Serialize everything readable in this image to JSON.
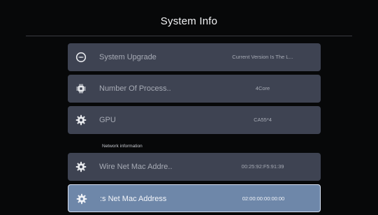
{
  "header": {
    "title": "System Info"
  },
  "rows": [
    {
      "icon": "upgrade-icon",
      "label": "System Upgrade",
      "value": "Current Version Is The L..."
    },
    {
      "icon": "chip-icon",
      "label": "Number Of Process..",
      "value": "4Core"
    },
    {
      "icon": "gear-icon",
      "label": "GPU",
      "value": "CA55*4"
    }
  ],
  "network": {
    "section_label": "Network information",
    "rows": [
      {
        "icon": "gear-icon",
        "label": "Wire Net Mac Addre..",
        "value": "00:25:92:F5:91:39"
      },
      {
        "icon": "gear-icon",
        "label": ":s Net Mac Address",
        "value": "02:00:00:00:00:00",
        "selected": true
      }
    ]
  },
  "colors": {
    "background": "#070809",
    "row": "#3e4352",
    "row_selected": "#6e87a9",
    "text": "#a7abb5"
  }
}
